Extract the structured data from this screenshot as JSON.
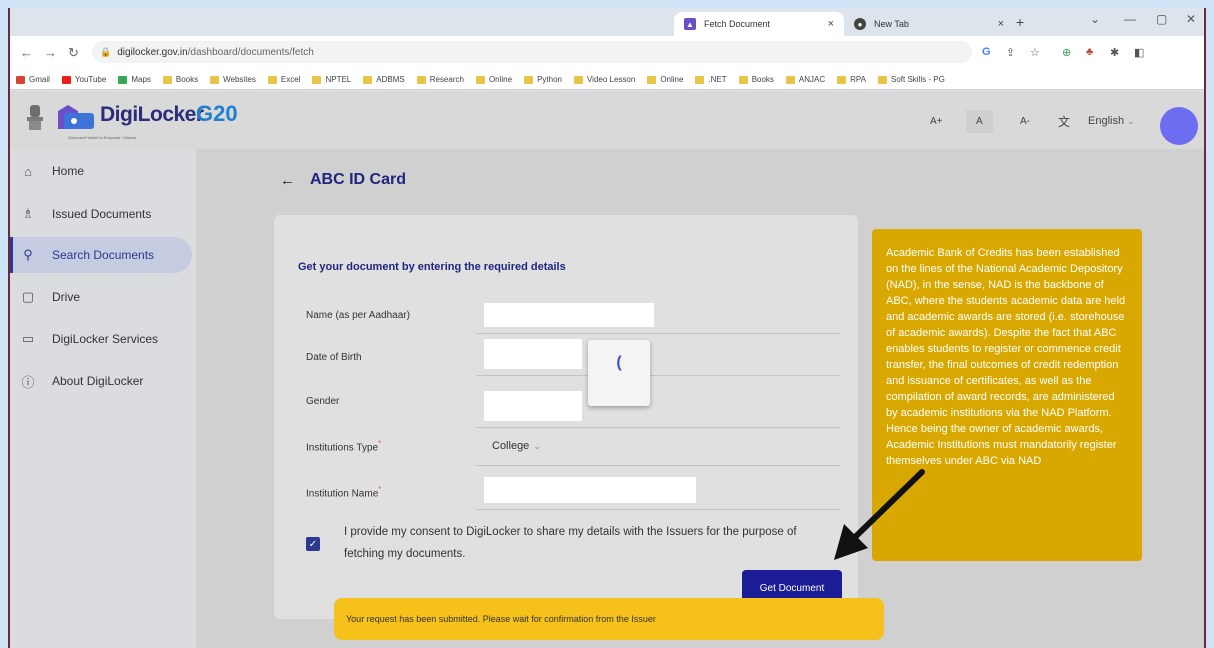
{
  "browser": {
    "tabs": [
      {
        "title": "Fetch Document",
        "active": true
      },
      {
        "title": "New Tab",
        "active": false
      }
    ],
    "new_tab": "+",
    "close_glyph": "×",
    "url_host": "digilocker.gov.in",
    "url_path": "/dashboard/documents/fetch",
    "bookmarks": [
      {
        "label": "Gmail",
        "color": "#d44638"
      },
      {
        "label": "YouTube",
        "color": "#e62117"
      },
      {
        "label": "Maps",
        "color": "#34a853"
      },
      {
        "label": "Books",
        "color": "#e8c547"
      },
      {
        "label": "Websites",
        "color": "#e8c547"
      },
      {
        "label": "Excel",
        "color": "#e8c547"
      },
      {
        "label": "NPTEL",
        "color": "#e8c547"
      },
      {
        "label": "ADBMS",
        "color": "#e8c547"
      },
      {
        "label": "Research",
        "color": "#e8c547"
      },
      {
        "label": "Online",
        "color": "#e8c547"
      },
      {
        "label": "Python",
        "color": "#e8c547"
      },
      {
        "label": "Video Lesson",
        "color": "#e8c547"
      },
      {
        "label": "Online",
        "color": "#e8c547"
      },
      {
        "label": ".NET",
        "color": "#e8c547"
      },
      {
        "label": "Books",
        "color": "#e8c547"
      },
      {
        "label": "ANJAC",
        "color": "#e8c547"
      },
      {
        "label": "RPA",
        "color": "#e8c547"
      },
      {
        "label": "Soft Skills - PG",
        "color": "#e8c547"
      }
    ]
  },
  "header": {
    "brand": "DigiLocker",
    "tagline": "Document Wallet to Empower Citizens",
    "g20": "G20",
    "font_sizes": [
      "A+",
      "A",
      "A-"
    ],
    "language": "English",
    "language_caret": "⌄"
  },
  "sidebar": {
    "items": [
      {
        "label": "Home",
        "icon": "home-icon",
        "glyph": "⌂"
      },
      {
        "label": "Issued Documents",
        "icon": "issued-icon",
        "glyph": "♗"
      },
      {
        "label": "Search Documents",
        "icon": "search-icon",
        "glyph": "⚲",
        "active": true
      },
      {
        "label": "Drive",
        "icon": "drive-icon",
        "glyph": "▢"
      },
      {
        "label": "DigiLocker Services",
        "icon": "services-icon",
        "glyph": "▭"
      },
      {
        "label": "About DigiLocker",
        "icon": "info-icon",
        "glyph": "ⓘ"
      }
    ]
  },
  "main": {
    "back_glyph": "←",
    "title": "ABC ID Card",
    "form_heading": "Get your document by entering the required details",
    "fields": {
      "name_label": "Name (as per Aadhaar)",
      "dob_label": "Date of Birth",
      "gender_label": "Gender",
      "inst_type_label": "Institutions Type",
      "inst_type_value": "College",
      "inst_name_label": "Institution Name",
      "required_mark": "*",
      "select_caret": "⌄"
    },
    "spinner_glyph": "(",
    "consent_checked": true,
    "consent_text": "I provide my consent to DigiLocker to share my details with the Issuers for the purpose of fetching my documents.",
    "submit_label": "Get Document",
    "info_text": "Academic Bank of Credits has been established on the lines of the National Academic Depository (NAD), in the sense, NAD is the backbone of ABC, where the students academic data are held and academic awards are stored (i.e. storehouse of academic awards). Despite the fact that ABC enables students to register or commence credit transfer, the final outcomes of credit redemption and issuance of certificates, as well as the compilation of award records, are administered by academic institutions via the NAD Platform. Hence being the owner of academic awards, Academic Institutions must mandatorily register themselves under ABC via NAD"
  },
  "toast": {
    "message": "Your request has been submitted. Please wait for confirmation from the Issuer"
  },
  "colors": {
    "brand_blue": "#1f2680",
    "button": "#1c1c96",
    "info_bg": "#d9a800",
    "toast_bg": "#f5c11a",
    "avatar": "#6d6df2"
  }
}
